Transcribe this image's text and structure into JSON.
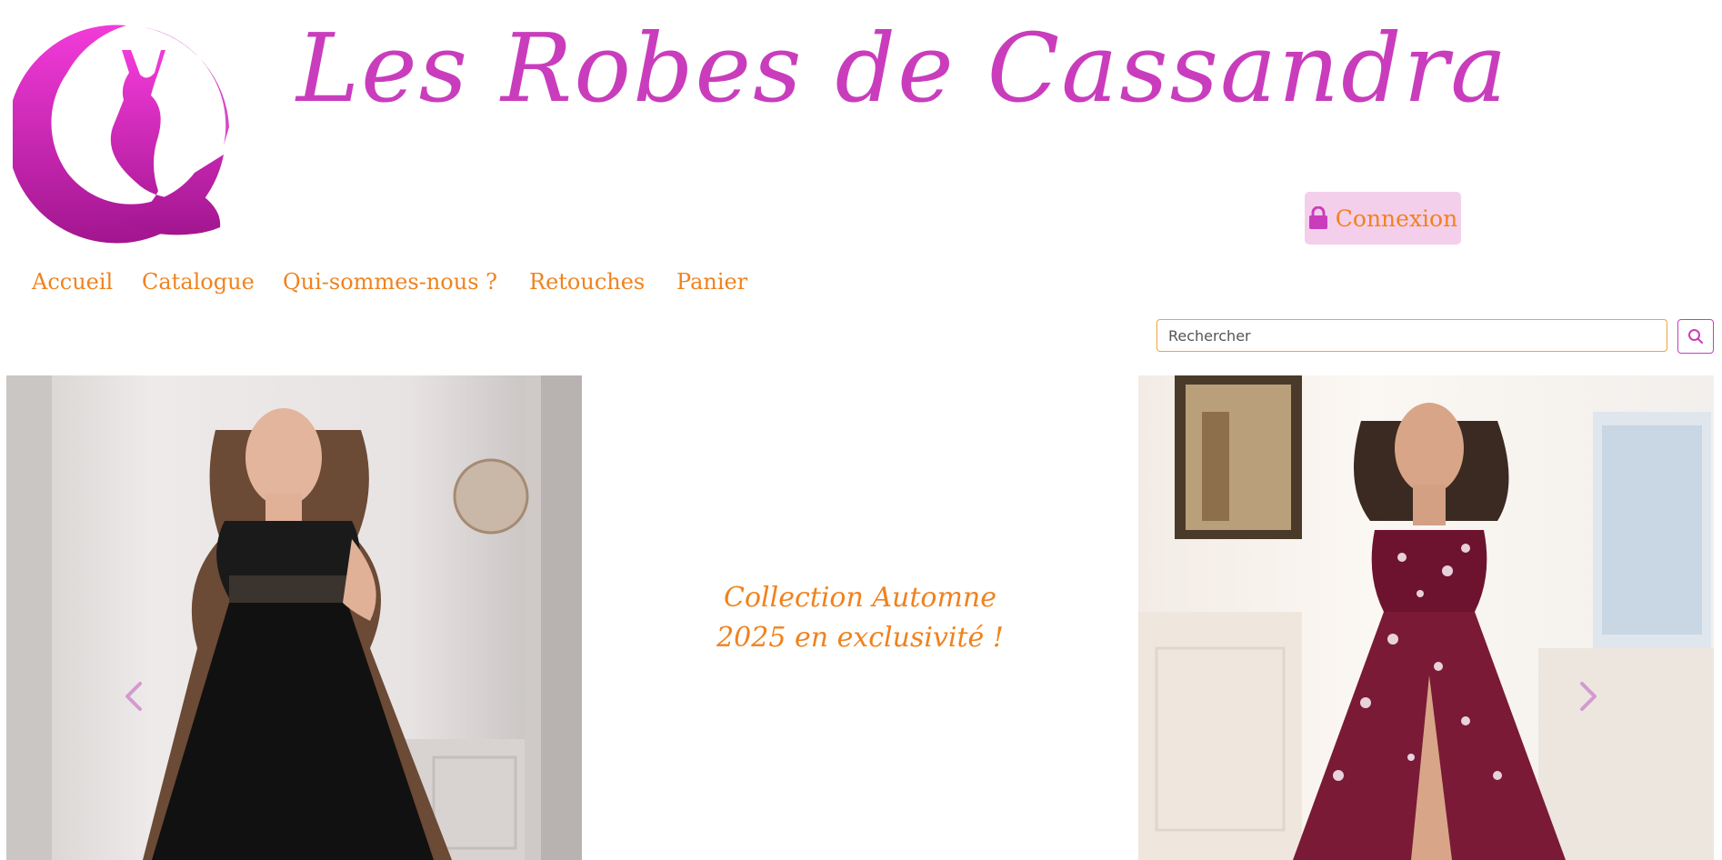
{
  "header": {
    "site_title": "Les Robes de Cassandra",
    "login_label": "Connexion"
  },
  "nav": {
    "items": [
      "Accueil",
      "Catalogue",
      "Qui-sommes-nous ?",
      "Retouches",
      "Panier"
    ]
  },
  "search": {
    "placeholder": "Rechercher"
  },
  "carousel": {
    "caption": "Collection Automne\n2025 en exclusivité !"
  },
  "colors": {
    "brand_pink": "#c93dbd",
    "accent_orange": "#f0821e",
    "login_bg": "#f4cfeb"
  },
  "icons": {
    "login": "lock-icon",
    "search": "search-icon",
    "prev": "chevron-left-icon",
    "next": "chevron-right-icon"
  }
}
